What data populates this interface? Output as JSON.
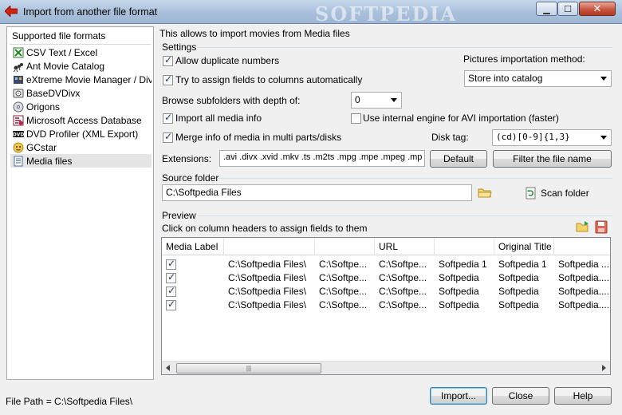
{
  "window": {
    "title": "Import from another file format",
    "watermark": "SOFTPEDIA"
  },
  "left_panel": {
    "header": "Supported file formats",
    "items": [
      {
        "label": "CSV Text / Excel",
        "icon": "csv-excel-icon"
      },
      {
        "label": "Ant Movie Catalog",
        "icon": "ant-icon"
      },
      {
        "label": "eXtreme Movie Manager / Div...",
        "icon": "film-icon"
      },
      {
        "label": "BaseDVDivx",
        "icon": "disc-icon"
      },
      {
        "label": "Origons",
        "icon": "disc-icon"
      },
      {
        "label": "Microsoft Access Database",
        "icon": "access-icon"
      },
      {
        "label": "DVD Profiler (XML Export)",
        "icon": "dvd-icon"
      },
      {
        "label": "GCstar",
        "icon": "gcstar-icon"
      },
      {
        "label": "Media files",
        "icon": "media-files-icon"
      }
    ],
    "selected_index": 8
  },
  "main": {
    "description": "This allows to import movies from Media files",
    "settings_label": "Settings",
    "allow_duplicates": "Allow duplicate numbers",
    "assign_fields": "Try to assign fields to columns automatically",
    "pictures_label": "Pictures importation method:",
    "pictures_value": "Store into catalog",
    "subfolders_label": "Browse subfolders with depth of:",
    "subfolders_value": "0",
    "import_all_info": "Import all media info",
    "internal_engine": "Use internal engine for AVI importation (faster)",
    "merge_info": "Merge info of media in multi parts/disks",
    "disk_tag_label": "Disk tag:",
    "disk_tag_value": "(cd)[0-9]{1,3}",
    "extensions_label": "Extensions:",
    "extensions_value": ".avi .divx .xvid .mkv .ts .m2ts .mpg .mpe .mpeg .mp",
    "default_button": "Default",
    "filter_button": "Filter the file name",
    "source_folder_label": "Source folder",
    "source_folder_value": "C:\\Softpedia Files",
    "scan_folder_button": "Scan folder",
    "preview_label": "Preview",
    "preview_hint": "Click on column headers to assign fields to them"
  },
  "preview_table": {
    "columns": [
      "Media Label",
      "",
      "",
      "URL",
      "",
      "Original Title",
      ""
    ],
    "rows": [
      {
        "checked": true,
        "cells": [
          "C:\\Softpedia Files\\",
          "C:\\Softpe...",
          "C:\\Softpe...",
          "Softpedia 1",
          "Softpedia 1",
          "Softpedia ..."
        ]
      },
      {
        "checked": true,
        "cells": [
          "C:\\Softpedia Files\\",
          "C:\\Softpe...",
          "C:\\Softpe...",
          "Softpedia",
          "Softpedia",
          "Softpedia...."
        ]
      },
      {
        "checked": true,
        "cells": [
          "C:\\Softpedia Files\\",
          "C:\\Softpe...",
          "C:\\Softpe...",
          "Softpedia",
          "Softpedia",
          "Softpedia...."
        ]
      },
      {
        "checked": true,
        "cells": [
          "C:\\Softpedia Files\\",
          "C:\\Softpe...",
          "C:\\Softpe...",
          "Softpedia",
          "Softpedia",
          "Softpedia...."
        ]
      }
    ]
  },
  "footer": {
    "file_path": "File Path = C:\\Softpedia Files\\",
    "import_button": "Import...",
    "close_button": "Close",
    "help_button": "Help"
  },
  "colors": {
    "titlebar": "#a9c0db",
    "close_button": "#c8553f",
    "frame": "#f0f0f0"
  }
}
